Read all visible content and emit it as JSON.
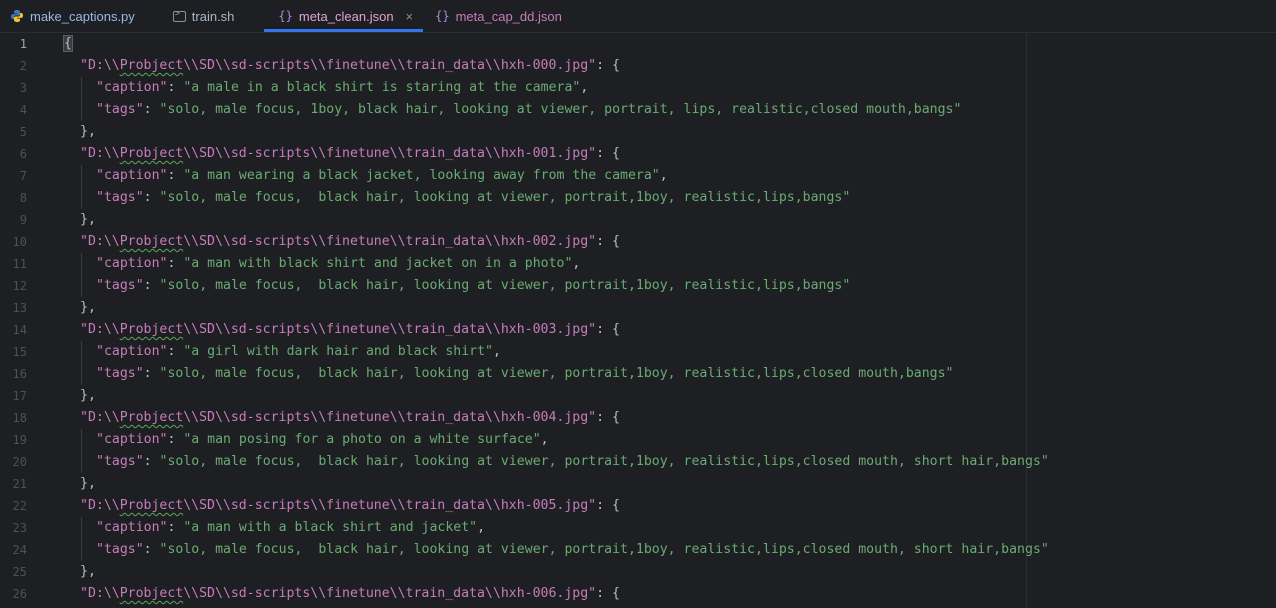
{
  "tabs": [
    {
      "label": "make_captions.py",
      "icon": "python-icon",
      "active": false
    },
    {
      "label": "train.sh",
      "icon": "terminal-icon",
      "active": false
    },
    {
      "label": "meta_clean.json",
      "icon": "json-icon",
      "active": true,
      "close": "×"
    },
    {
      "label": "meta_cap_dd.json",
      "icon": "json-icon",
      "active": false
    }
  ],
  "json_icon_glyph": "{}",
  "editor": {
    "line_numbers": [
      "1",
      "2",
      "3",
      "4",
      "5",
      "6",
      "7",
      "8",
      "9",
      "10",
      "11",
      "12",
      "13",
      "14",
      "15",
      "16",
      "17",
      "18",
      "19",
      "20",
      "21",
      "22",
      "23",
      "24",
      "25",
      "26"
    ],
    "open_brace": "{",
    "close_entry": "},",
    "colon": ": ",
    "entry_open": ": {",
    "comma": ",",
    "caption_key": "\"caption\"",
    "tags_key": "\"tags\"",
    "path_prefix": "\"D:\\\\",
    "path_wavy": "Probject",
    "path_suffixes": [
      "\\\\SD\\\\sd-scripts\\\\finetune\\\\train_data\\\\hxh-000.jpg\"",
      "\\\\SD\\\\sd-scripts\\\\finetune\\\\train_data\\\\hxh-001.jpg\"",
      "\\\\SD\\\\sd-scripts\\\\finetune\\\\train_data\\\\hxh-002.jpg\"",
      "\\\\SD\\\\sd-scripts\\\\finetune\\\\train_data\\\\hxh-003.jpg\"",
      "\\\\SD\\\\sd-scripts\\\\finetune\\\\train_data\\\\hxh-004.jpg\"",
      "\\\\SD\\\\sd-scripts\\\\finetune\\\\train_data\\\\hxh-005.jpg\"",
      "\\\\SD\\\\sd-scripts\\\\finetune\\\\train_data\\\\hxh-006.jpg\""
    ],
    "captions": [
      "\"a male in a black shirt is staring at the camera\"",
      "\"a man wearing a black jacket, looking away from the camera\"",
      "\"a man with black shirt and jacket on in a photo\"",
      "\"a girl with dark hair and black shirt\"",
      "\"a man posing for a photo on a white surface\"",
      "\"a man with a black shirt and jacket\""
    ],
    "tags": [
      "\"solo, male focus, 1boy, black hair, looking at viewer, portrait, lips, realistic,closed mouth,bangs\"",
      "\"solo, male focus,  black hair, looking at viewer, portrait,1boy, realistic,lips,bangs\"",
      "\"solo, male focus,  black hair, looking at viewer, portrait,1boy, realistic,lips,bangs\"",
      "\"solo, male focus,  black hair, looking at viewer, portrait,1boy, realistic,lips,closed mouth,bangs\"",
      "\"solo, male focus,  black hair, looking at viewer, portrait,1boy, realistic,lips,closed mouth, short hair,bangs\"",
      "\"solo, male focus,  black hair, looking at viewer, portrait,1boy, realistic,lips,closed mouth, short hair,bangs\""
    ]
  }
}
